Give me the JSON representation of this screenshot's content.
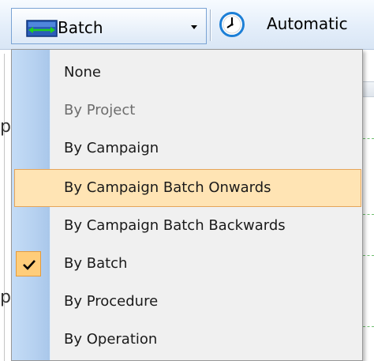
{
  "toolbar": {
    "batch_dropdown_label": "Batch",
    "automatic_label": "Automatic",
    "icons": {
      "batch": "batch-span-icon",
      "dropdown": "chevron-down-icon",
      "clock": "clock-icon"
    }
  },
  "background": {
    "fragment_1": "p",
    "fragment_2": "p"
  },
  "menu": {
    "items": [
      {
        "label": "None",
        "enabled": true,
        "checked": false,
        "hovered": false
      },
      {
        "label": "By Project",
        "enabled": false,
        "checked": false,
        "hovered": false
      },
      {
        "label": "By Campaign",
        "enabled": true,
        "checked": false,
        "hovered": false
      },
      {
        "label": "By Campaign Batch Onwards",
        "enabled": true,
        "checked": false,
        "hovered": true
      },
      {
        "label": "By Campaign Batch Backwards",
        "enabled": true,
        "checked": false,
        "hovered": false
      },
      {
        "label": "By Batch",
        "enabled": true,
        "checked": true,
        "hovered": false
      },
      {
        "label": "By Procedure",
        "enabled": true,
        "checked": false,
        "hovered": false
      },
      {
        "label": "By Operation",
        "enabled": true,
        "checked": false,
        "hovered": false
      }
    ]
  },
  "colors": {
    "hover_fill": "#ffe4b4",
    "hover_border": "#e5a55a",
    "check_fill": "#ffcd7a",
    "gutter": "#b6d1f0",
    "icon_blue": "#1f4fa8",
    "icon_green": "#1fc41f"
  }
}
